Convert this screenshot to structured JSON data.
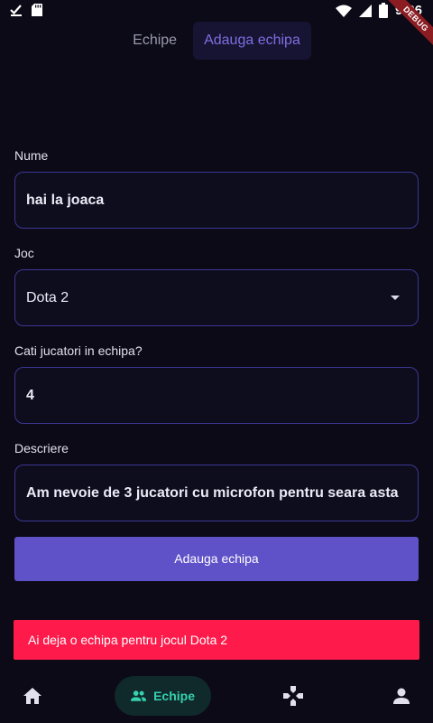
{
  "status_bar": {
    "time": "9:26",
    "debug_label": "DEBUG"
  },
  "tabs": [
    {
      "label": "Echipe",
      "active": false
    },
    {
      "label": "Adauga echipa",
      "active": true
    }
  ],
  "form": {
    "name": {
      "label": "Nume",
      "value": "hai la joaca"
    },
    "game": {
      "label": "Joc",
      "value": "Dota 2"
    },
    "players": {
      "label": "Cati jucatori in echipa?",
      "value": "4"
    },
    "description": {
      "label": "Descriere",
      "value": "Am nevoie de 3 jucatori cu microfon pentru seara asta"
    },
    "submit_label": "Adauga echipa"
  },
  "snackbar": {
    "message": "Ai deja o echipa pentru jocul Dota 2"
  },
  "bottom_nav": {
    "items": [
      {
        "icon": "home-icon",
        "label": ""
      },
      {
        "icon": "group-icon",
        "label": "Echipe",
        "active": true
      },
      {
        "icon": "gamepad-icon",
        "label": ""
      },
      {
        "icon": "person-icon",
        "label": ""
      }
    ]
  },
  "colors": {
    "background": "#0b0a16",
    "accent": "#5f52c8",
    "field_border": "#3d3794",
    "error": "#fe1a4a",
    "nav_active": "#36d1b0"
  }
}
